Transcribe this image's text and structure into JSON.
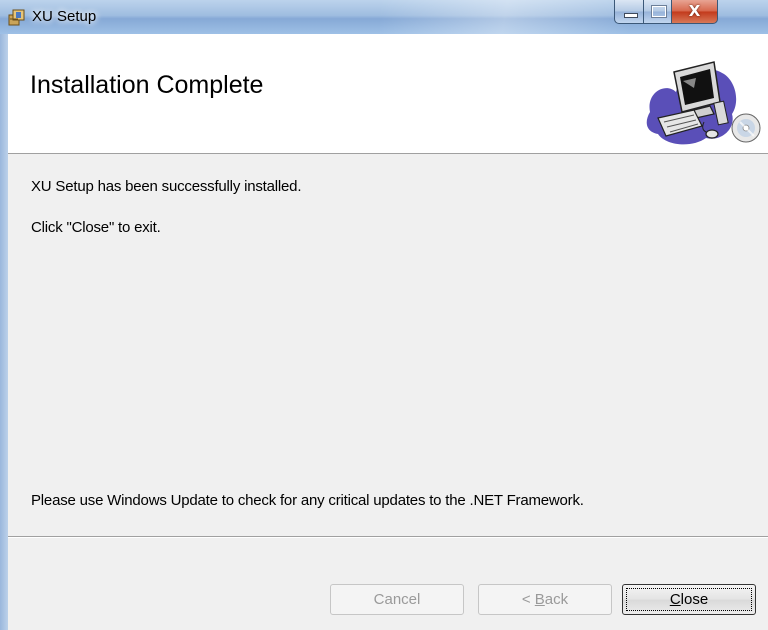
{
  "window": {
    "title": "XU Setup",
    "icons": {
      "app": "setup-package-icon",
      "minimize": "minimize-icon",
      "maximize": "maximize-icon",
      "close": "close-icon"
    },
    "close_glyph": "X"
  },
  "banner": {
    "title": "Installation Complete",
    "art": "computer-install-icon"
  },
  "body": {
    "line1": "XU Setup has been successfully installed.",
    "line2": "Click \"Close\" to exit.",
    "line3": "Please use Windows Update to check for any critical updates to the .NET Framework."
  },
  "buttons": {
    "cancel": {
      "label": "Cancel",
      "enabled": false
    },
    "back": {
      "prefix": "< ",
      "mnemonic": "B",
      "rest": "ack",
      "enabled": false
    },
    "close": {
      "mnemonic": "C",
      "rest": "lose",
      "enabled": true
    }
  },
  "colors": {
    "titlebar": "#9fbde0",
    "close_button": "#c2391b",
    "dialog_bg": "#f0f0f0",
    "banner_bg": "#ffffff"
  }
}
